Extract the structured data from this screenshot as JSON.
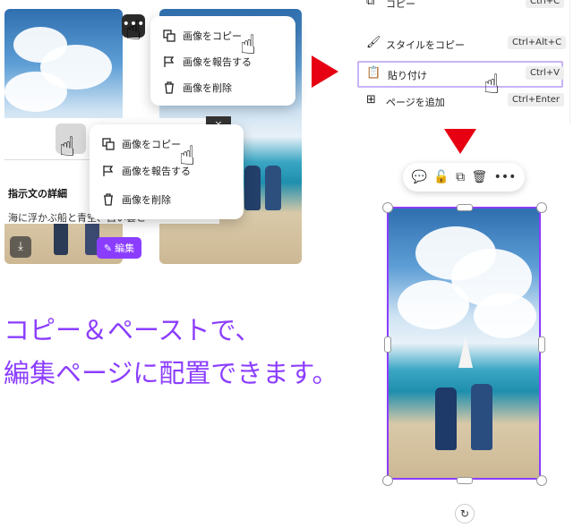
{
  "context_menu_top": {
    "items": [
      {
        "label": "画像をコピー",
        "icon": "copy-icon"
      },
      {
        "label": "画像を報告する",
        "icon": "flag-icon"
      },
      {
        "label": "画像を削除",
        "icon": "trash-icon"
      }
    ]
  },
  "context_menu_front": {
    "items": [
      {
        "label": "画像をコピー",
        "icon": "copy-icon"
      },
      {
        "label": "画像を報告する",
        "icon": "flag-icon"
      },
      {
        "label": "画像を削除",
        "icon": "trash-icon"
      }
    ]
  },
  "detail_panel": {
    "heading": "指示文の詳細",
    "text": "海に浮かぶ船と青空、白い雲と",
    "edit_button": "編集",
    "close_symbol": "×"
  },
  "editor_menu": {
    "items": [
      {
        "label": "コピー",
        "shortcut": "Ctrl+C"
      },
      {
        "label": "スタイルをコピー",
        "shortcut": "Ctrl+Alt+C"
      },
      {
        "label": "貼り付け",
        "shortcut": "Ctrl+V",
        "highlighted": true
      },
      {
        "label": "ページを追加",
        "shortcut": "Ctrl+Enter"
      }
    ]
  },
  "caption": {
    "line1": "コピー＆ペーストで、",
    "line2": "編集ページに配置できます。"
  },
  "colors": {
    "accent": "#8b3dff",
    "arrow": "#e60012",
    "caption": "#8b3dff",
    "highlight_border": "#c9b3f5"
  }
}
